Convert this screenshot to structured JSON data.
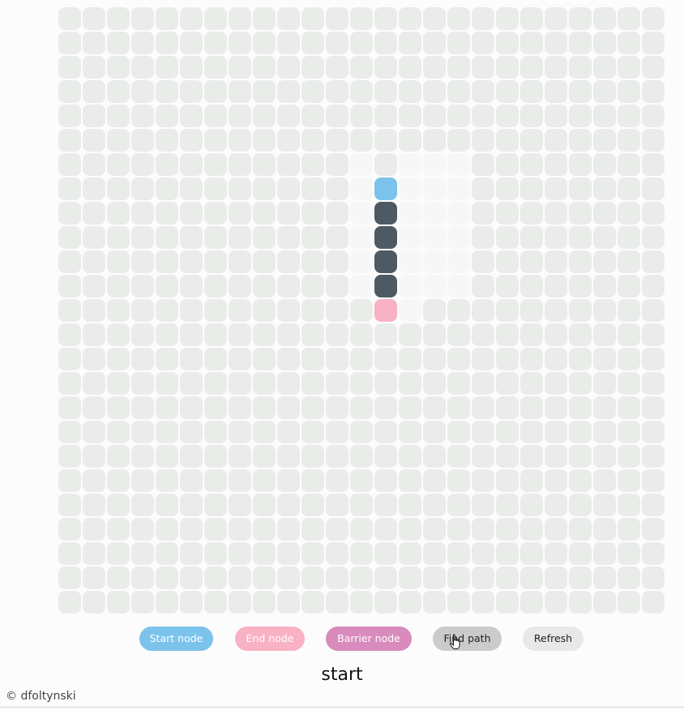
{
  "grid": {
    "rows": 25,
    "cols": 25,
    "start_cell": {
      "row": 7,
      "col": 13
    },
    "end_cell": {
      "row": 12,
      "col": 13
    },
    "barrier_cells": [
      {
        "row": 8,
        "col": 13
      },
      {
        "row": 9,
        "col": 13
      },
      {
        "row": 10,
        "col": 13
      },
      {
        "row": 11,
        "col": 13
      }
    ],
    "visited_cells": [
      {
        "row": 6,
        "col": 14
      },
      {
        "row": 6,
        "col": 15
      },
      {
        "row": 6,
        "col": 16
      },
      {
        "row": 7,
        "col": 14
      },
      {
        "row": 7,
        "col": 15
      },
      {
        "row": 7,
        "col": 16
      },
      {
        "row": 8,
        "col": 14
      },
      {
        "row": 8,
        "col": 15
      },
      {
        "row": 8,
        "col": 16
      },
      {
        "row": 9,
        "col": 14
      },
      {
        "row": 9,
        "col": 15
      },
      {
        "row": 9,
        "col": 16
      },
      {
        "row": 10,
        "col": 14
      },
      {
        "row": 10,
        "col": 15
      },
      {
        "row": 10,
        "col": 16
      },
      {
        "row": 11,
        "col": 14
      },
      {
        "row": 11,
        "col": 15
      },
      {
        "row": 11,
        "col": 16
      },
      {
        "row": 6,
        "col": 12
      },
      {
        "row": 7,
        "col": 12
      },
      {
        "row": 8,
        "col": 12
      },
      {
        "row": 9,
        "col": 12
      },
      {
        "row": 10,
        "col": 12
      },
      {
        "row": 11,
        "col": 12
      },
      {
        "row": 12,
        "col": 14
      }
    ]
  },
  "colors": {
    "empty": "#e9ece9",
    "visited": "#f6f7f6",
    "start": "#7cc3ec",
    "end": "#f9b2c3",
    "barrier": "#4e5a63",
    "barrier_button": "#d88bbc",
    "find_button": "#cbcbcb",
    "refresh_button": "#e8e8e8"
  },
  "buttons": {
    "start_node": "Start node",
    "end_node": "End node",
    "barrier_node": "Barrier node",
    "find_path": "Find path",
    "refresh": "Refresh"
  },
  "status_text": "start",
  "footer": "© dfoltynski",
  "cursor_icon": "hand-pointer-icon"
}
